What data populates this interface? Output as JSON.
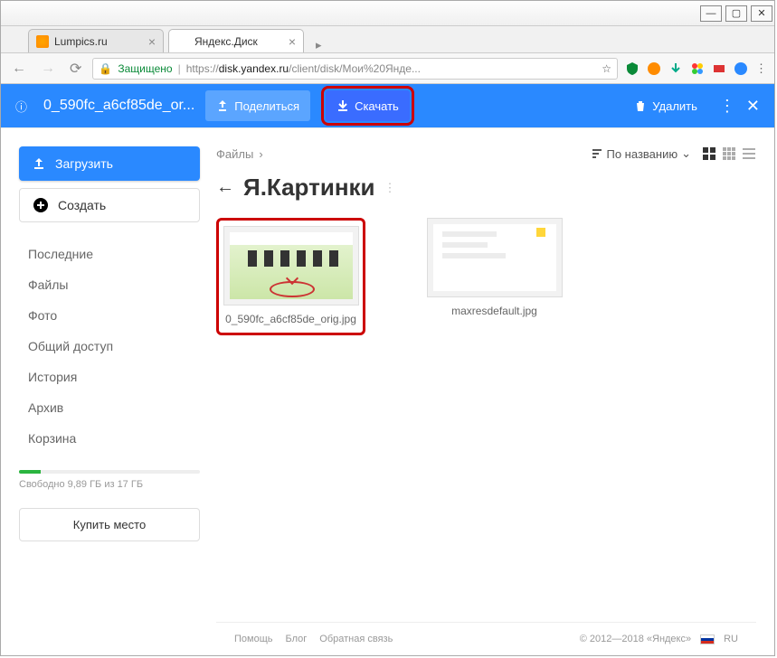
{
  "window": {
    "min": "—",
    "max": "▢",
    "close": "✕"
  },
  "tabs": [
    {
      "title": "Lumpics.ru"
    },
    {
      "title": "Яндекс.Диск"
    }
  ],
  "addressbar": {
    "secure_label": "Защищено",
    "url_prefix": "https://",
    "url_host": "disk.yandex.ru",
    "url_rest": "/client/disk/Мои%20Янде...",
    "star": "☆"
  },
  "bluebar": {
    "info_icon": "ⓘ",
    "file_name": "0_590fc_a6cf85de_or...",
    "share": "Поделиться",
    "download": "Скачать",
    "delete": "Удалить",
    "more": "⋮",
    "close": "✕"
  },
  "sidebar": {
    "upload": "Загрузить",
    "create": "Создать",
    "items": [
      "Последние",
      "Файлы",
      "Фото",
      "Общий доступ",
      "История",
      "Архив",
      "Корзина"
    ],
    "storage_label": "Свободно 9,89 ГБ из 17 ГБ",
    "buy": "Купить место"
  },
  "main": {
    "crumb_root": "Файлы",
    "crumb_sep": "›",
    "sort": "По названию",
    "back": "←",
    "folder": "Я.Картинки",
    "files": [
      {
        "name": "0_590fc_a6cf85de_orig.jpg"
      },
      {
        "name": "maxresdefault.jpg"
      }
    ]
  },
  "footer": {
    "help": "Помощь",
    "blog": "Блог",
    "feedback": "Обратная связь",
    "copyright": "© 2012—2018 «Яндекс»",
    "lang": "RU"
  }
}
